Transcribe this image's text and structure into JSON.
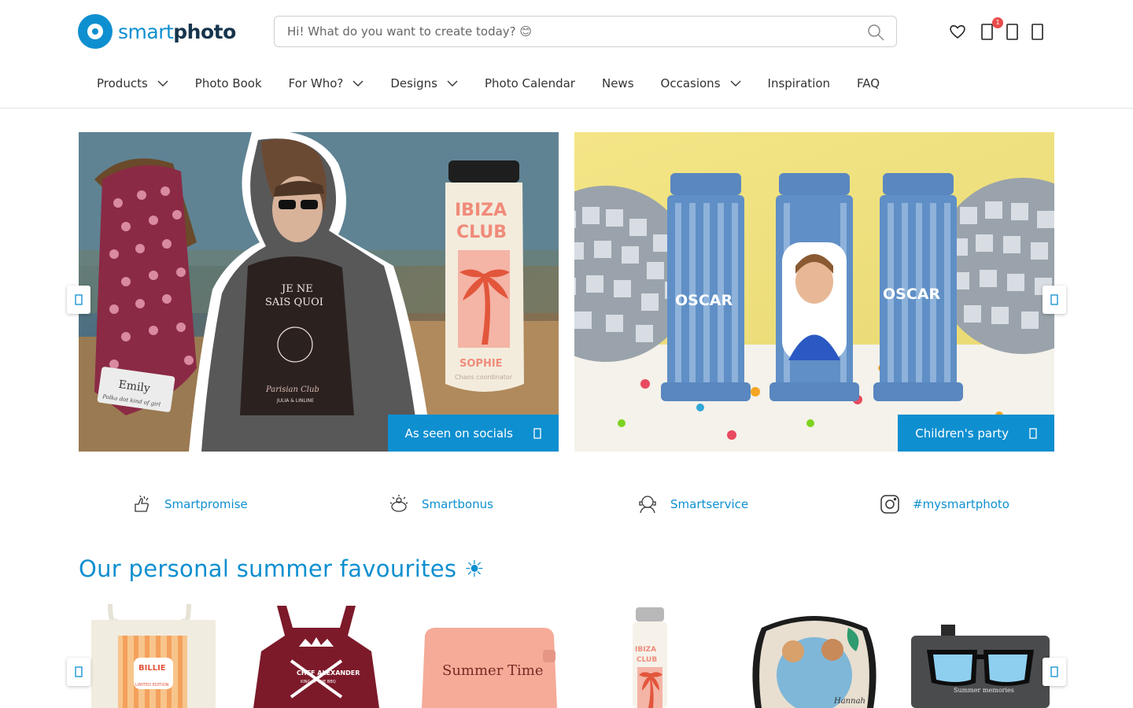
{
  "logo": {
    "part1": "smart",
    "part2": "photo"
  },
  "search": {
    "placeholder": "Hi! What do you want to create today? 😊"
  },
  "header": {
    "cart_badge": "1"
  },
  "nav": {
    "items": [
      {
        "label": "Products",
        "has_dropdown": true
      },
      {
        "label": "Photo Book",
        "has_dropdown": false
      },
      {
        "label": "For Who?",
        "has_dropdown": true
      },
      {
        "label": "Designs",
        "has_dropdown": true
      },
      {
        "label": "Photo Calendar",
        "has_dropdown": false
      },
      {
        "label": "News",
        "has_dropdown": false
      },
      {
        "label": "Occasions",
        "has_dropdown": true
      },
      {
        "label": "Inspiration",
        "has_dropdown": false
      },
      {
        "label": "FAQ",
        "has_dropdown": false
      }
    ]
  },
  "hero": {
    "left": {
      "cta": "As seen on socials",
      "texts": {
        "shirt_line1": "JE NE",
        "shirt_line2": "SAIS QUOI",
        "shirt_script": "Parisian Club",
        "shirt_sub": "JULIA & LINLINE",
        "bottle_top": "IBIZA",
        "bottle_mid": "CLUB",
        "bottle_name": "SOPHIE",
        "bottle_sub": "Chaos coordinator",
        "towel_name": "Emily",
        "towel_sub": "Polka dot kind of girl"
      }
    },
    "right": {
      "cta": "Children's party",
      "texts": {
        "label_left": "OSCAR",
        "label_right": "OSCAR"
      }
    }
  },
  "usps": [
    {
      "label": "Smartpromise",
      "icon": "promise-icon"
    },
    {
      "label": "Smartbonus",
      "icon": "bonus-icon"
    },
    {
      "label": "Smartservice",
      "icon": "service-icon"
    },
    {
      "label": "#mysmartphoto",
      "icon": "instagram-icon"
    }
  ],
  "section": {
    "title": "Our personal summer favourites ☀"
  },
  "products": {
    "tote": {
      "name": "BILLIE",
      "sub": "LIMITED EDITION"
    },
    "apron": {
      "name": "CHEF ALEXANDER",
      "sub": "KING OF THE BBQ"
    },
    "pouch": {
      "name": "Summer Time"
    },
    "bottle": {
      "top": "IBIZA",
      "mid": "CLUB"
    },
    "shade": {
      "name": "Hannah"
    },
    "case": {
      "name": "Summer memories"
    }
  },
  "colors": {
    "brand_blue": "#0e8fd0",
    "logo_dark": "#16344c",
    "badge_red": "#e94b4b"
  }
}
